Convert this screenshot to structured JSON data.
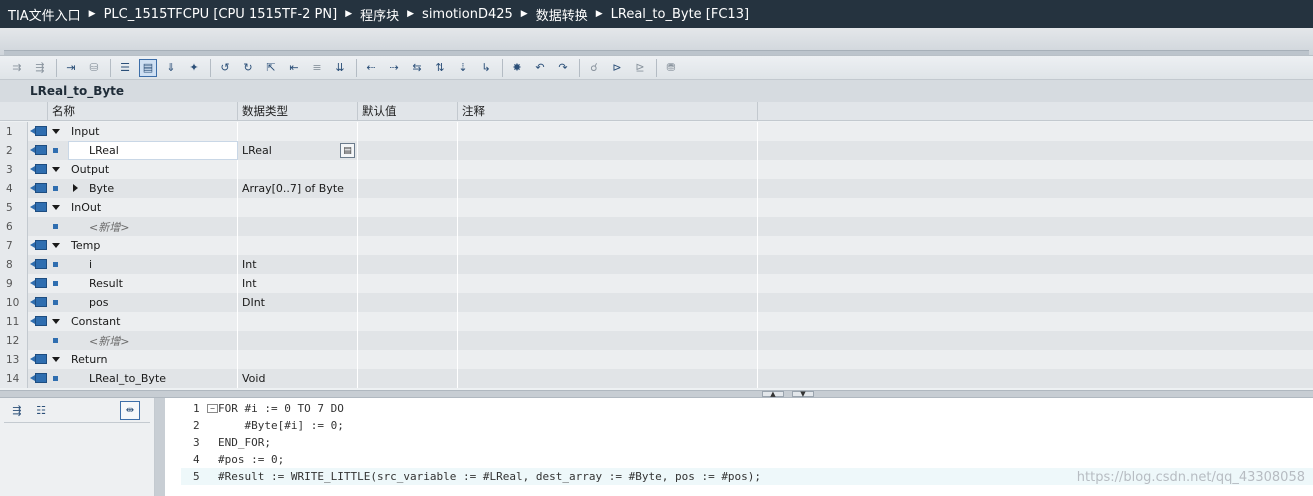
{
  "breadcrumb": [
    "TIA文件入口",
    "PLC_1515TFCPU [CPU 1515TF-2 PN]",
    "程序块",
    "simotionD425",
    "数据转换",
    "LReal_to_Byte [FC13]"
  ],
  "block_title": "LReal_to_Byte",
  "table": {
    "headers": {
      "name": "名称",
      "type": "数据类型",
      "default": "默认值",
      "comment": "注释"
    },
    "rows": [
      {
        "num": "1",
        "name": "Input",
        "type": "",
        "kind": "section"
      },
      {
        "num": "2",
        "name": "LReal",
        "type": "LReal",
        "kind": "var",
        "editing": true
      },
      {
        "num": "3",
        "name": "Output",
        "type": "",
        "kind": "section"
      },
      {
        "num": "4",
        "name": "Byte",
        "type": "Array[0..7] of Byte",
        "kind": "var",
        "expandable": true
      },
      {
        "num": "5",
        "name": "InOut",
        "type": "",
        "kind": "section"
      },
      {
        "num": "6",
        "name": "<新增>",
        "type": "",
        "kind": "add"
      },
      {
        "num": "7",
        "name": "Temp",
        "type": "",
        "kind": "section"
      },
      {
        "num": "8",
        "name": "i",
        "type": "Int",
        "kind": "var"
      },
      {
        "num": "9",
        "name": "Result",
        "type": "Int",
        "kind": "var"
      },
      {
        "num": "10",
        "name": "pos",
        "type": "DInt",
        "kind": "var"
      },
      {
        "num": "11",
        "name": "Constant",
        "type": "",
        "kind": "section"
      },
      {
        "num": "12",
        "name": "<新增>",
        "type": "",
        "kind": "add"
      },
      {
        "num": "13",
        "name": "Return",
        "type": "",
        "kind": "section"
      },
      {
        "num": "14",
        "name": "LReal_to_Byte",
        "type": "Void",
        "kind": "var"
      }
    ]
  },
  "code": {
    "lines": [
      {
        "num": "1",
        "text": "FOR #i := 0 TO 7 DO"
      },
      {
        "num": "2",
        "text": "    #Byte[#i] := 0;"
      },
      {
        "num": "3",
        "text": "END_FOR;"
      },
      {
        "num": "4",
        "text": "#pos := 0;"
      },
      {
        "num": "5",
        "text": "#Result := WRITE_LITTLE(src_variable := #LReal, dest_array := #Byte, pos := #pos);"
      }
    ]
  },
  "toolbar_icons": [
    "insert-network-icon",
    "delete-network-icon",
    "insert-row-icon",
    "download-icon",
    "monitor-icon",
    "compare-icon",
    "interface-view-icon",
    "export-icon",
    "favorites-icon",
    "set-breakpoint-icon",
    "delete-breakpoint-icon",
    "go-to-icon",
    "previous-icon",
    "next-icon",
    "cross-ref-icon",
    "indent-icon",
    "outdent-icon",
    "comment-icon",
    "uncomment-icon",
    "bookmark-icon",
    "prev-bookmark-icon",
    "next-bookmark-icon",
    "watch-icon",
    "monitoring-icon",
    "snapshot-icon",
    "database-icon"
  ],
  "watermark": "https://blog.csdn.net/qq_43308058"
}
